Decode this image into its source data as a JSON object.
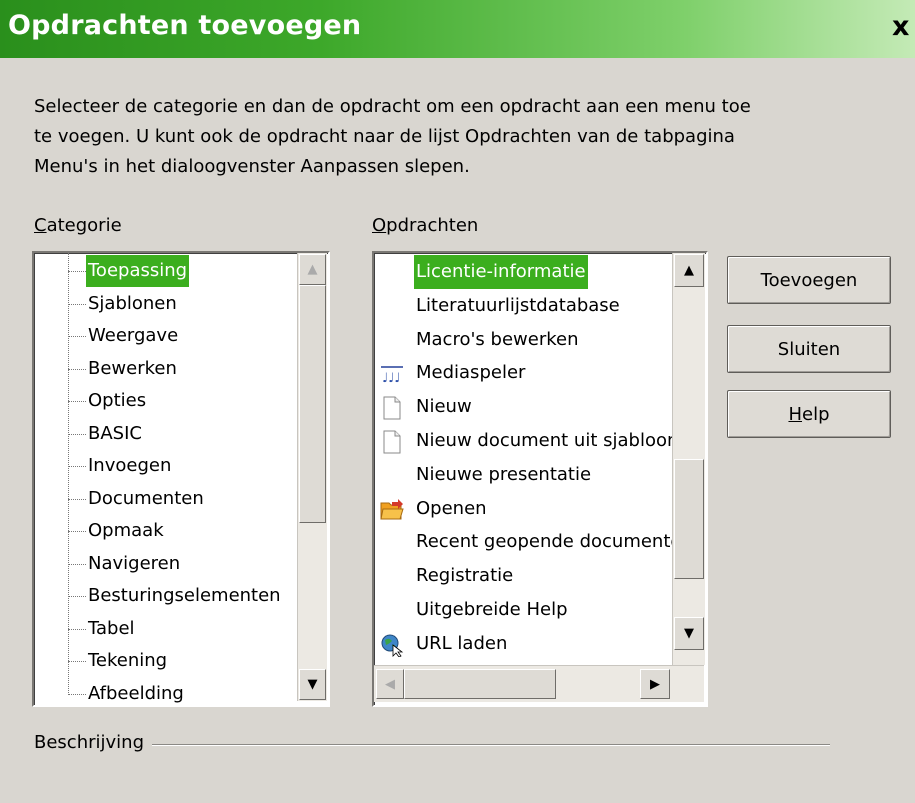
{
  "window": {
    "title": "Opdrachten toevoegen",
    "close_glyph": "x"
  },
  "description": "Selecteer de categorie en dan de opdracht om een opdracht aan een menu toe te voegen. U kunt ook de opdracht naar de lijst Opdrachten van de tabpagina Menu's in het dialoogvenster Aanpassen slepen.",
  "category": {
    "label_mnemonic": "C",
    "label_rest": "ategorie",
    "selected": "Toepassing",
    "items": [
      "Toepassing",
      "Sjablonen",
      "Weergave",
      "Bewerken",
      "Opties",
      "BASIC",
      "Invoegen",
      "Documenten",
      "Opmaak",
      "Navigeren",
      "Besturingselementen",
      "Tabel",
      "Tekening",
      "Afbeelding"
    ]
  },
  "commands": {
    "label_mnemonic": "O",
    "label_rest": "pdrachten",
    "selected": "Licentie-informatie",
    "items": [
      {
        "label": "Licentie-informatie",
        "icon": ""
      },
      {
        "label": "Literatuurlijstdatabase",
        "icon": ""
      },
      {
        "label": "Macro's bewerken",
        "icon": ""
      },
      {
        "label": "Mediaspeler",
        "icon": "media-player-icon"
      },
      {
        "label": "Nieuw",
        "icon": "new-document-icon"
      },
      {
        "label": "Nieuw document uit sjabloon",
        "icon": "new-document-icon"
      },
      {
        "label": "Nieuwe presentatie",
        "icon": ""
      },
      {
        "label": "Openen",
        "icon": "open-folder-icon"
      },
      {
        "label": "Recent geopende documenten",
        "icon": ""
      },
      {
        "label": "Registratie",
        "icon": ""
      },
      {
        "label": "Uitgebreide Help",
        "icon": ""
      },
      {
        "label": "URL laden",
        "icon": "globe-icon"
      }
    ]
  },
  "buttons": {
    "add": "Toevoegen",
    "close": "Sluiten",
    "help_mnemonic": "H",
    "help_rest": "elp"
  },
  "description_group": {
    "label": "Beschrijving"
  },
  "colors": {
    "title_gradient_start": "#2a8f1c",
    "selection": "#3bae1e",
    "dialog_bg": "#d9d6d0"
  }
}
